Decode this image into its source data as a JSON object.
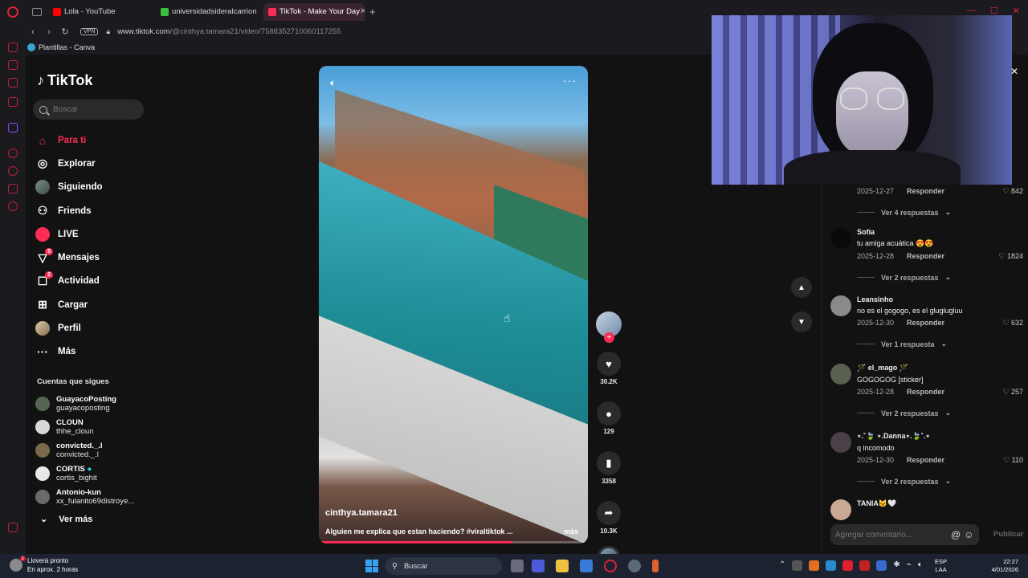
{
  "browser": {
    "tabs": [
      {
        "label": "Lola - YouTube",
        "color": "#ff0000",
        "active": false
      },
      {
        "label": "universidadsideralcarrion",
        "color": "#3fbf3f",
        "active": false
      },
      {
        "label": "TikTok - Make Your Day",
        "color": "#fe2c55",
        "active": true
      }
    ],
    "new_tab": "+",
    "window_controls": [
      "—",
      "☐",
      "✕"
    ],
    "url_host": "www.tiktok.com",
    "url_path": "/@cinthya.tamara21/video/7588352710060117255",
    "vpn_label": "VPN",
    "bookmark": "Plantillas - Canva"
  },
  "sidebar": {
    "logo": "TikTok",
    "search_placeholder": "Buscar",
    "menu": [
      {
        "label": "Para ti",
        "icon": "home-icon",
        "glyph": "⌂",
        "active": true
      },
      {
        "label": "Explorar",
        "icon": "compass-icon",
        "glyph": "◎"
      },
      {
        "label": "Siguiendo",
        "icon": "following-avatar-icon",
        "glyph": ""
      },
      {
        "label": "Friends",
        "icon": "friends-icon",
        "glyph": "👥"
      },
      {
        "label": "LIVE",
        "icon": "live-icon",
        "glyph": ""
      },
      {
        "label": "Mensajes",
        "icon": "messages-icon",
        "glyph": "▽",
        "badge": "5"
      },
      {
        "label": "Actividad",
        "icon": "activity-icon",
        "glyph": "☐",
        "badge": "2"
      },
      {
        "label": "Cargar",
        "icon": "upload-icon",
        "glyph": "⊞"
      },
      {
        "label": "Perfil",
        "icon": "profile-avatar-icon",
        "glyph": ""
      },
      {
        "label": "Más",
        "icon": "more-icon",
        "glyph": "···"
      }
    ],
    "following_title": "Cuentas que sigues",
    "following": [
      {
        "name": "GuayacoPosting",
        "handle": "guayacoposting",
        "color": "#556655"
      },
      {
        "name": "CLOUN",
        "handle": "thhe_cloun",
        "color": "#d8d8d8"
      },
      {
        "name": "convicted._.l",
        "handle": "convicted._.l",
        "color": "#7a6a4a"
      },
      {
        "name": "CORTIS",
        "handle": "cortis_bighit",
        "color": "#e8e8e8"
      },
      {
        "name": "Antonio-kun",
        "handle": "xx_fulanito69distroye...",
        "color": "#6a6a6a"
      }
    ],
    "see_more": "Ver más"
  },
  "video": {
    "author": "cinthya.tamara21",
    "caption": "Alguien me explica que estan haciendo? #viraltiktok ...",
    "more": "más",
    "progress": 0.72
  },
  "actions": {
    "likes": "30.2K",
    "comments": "129",
    "saves": "3358",
    "shares": "10.3K"
  },
  "comments": [
    {
      "user": "",
      "text": "",
      "date": "2025-12-27",
      "reply": "Responder",
      "likes": "842",
      "view": "Ver 4 respuestas",
      "avatar": "#00000000"
    },
    {
      "user": "Sofía",
      "text": "tu amiga acuática 😍😍",
      "date": "2025-12-28",
      "reply": "Responder",
      "likes": "1824",
      "view": "Ver 2 respuestas",
      "avatar": "#0a0a0a"
    },
    {
      "user": "Leansinho",
      "text": "no es el gogogo, es el gluglugluu",
      "date": "2025-12-30",
      "reply": "Responder",
      "likes": "632",
      "view": "Ver 1 respuesta",
      "avatar": "#8a8a8a"
    },
    {
      "user": "🪄 el_mago 🪄",
      "text": "GOGOGOG [sticker]",
      "date": "2025-12-28",
      "reply": "Responder",
      "likes": "257",
      "view": "Ver 2 respuestas",
      "avatar": "#5a6050"
    },
    {
      "user": "⋆.˚🍃 ⋆.Danna⋆.🍃˚.⋆",
      "text": "q incomodo",
      "date": "2025-12-30",
      "reply": "Responder",
      "likes": "110",
      "view": "Ver 2 respuestas",
      "avatar": "#4a4048"
    },
    {
      "user": "TANIA🐱🤍",
      "text": "",
      "date": "",
      "reply": "",
      "likes": "",
      "view": "",
      "avatar": "#c9a894"
    }
  ],
  "comment_input": {
    "placeholder": "Agregar comentario...",
    "publish": "Publicar"
  },
  "taskbar": {
    "weather_title": "Lloverá pronto",
    "weather_sub": "En aprox. 2 horas",
    "weather_badge": "1",
    "search": "Buscar",
    "lang1": "ESP",
    "lang2": "LAA",
    "time": "22:27",
    "date": "4/01/2026"
  }
}
